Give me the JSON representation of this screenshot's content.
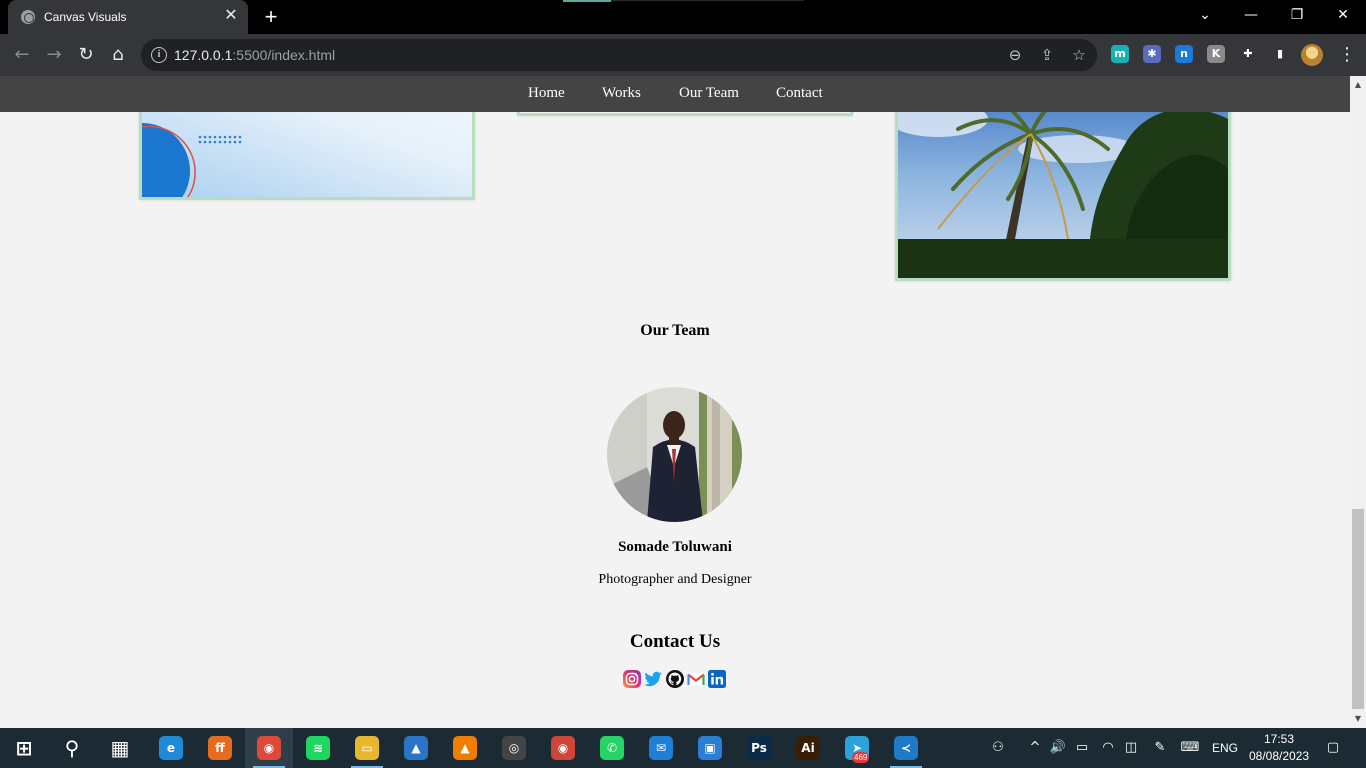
{
  "browser": {
    "tab_title": "Canvas Visuals",
    "tab_close": "✕",
    "new_tab": "+",
    "url_host": "127.0.0.1",
    "url_rest": ":5500/index.html",
    "window_controls": {
      "tabsearch": "⌄",
      "minimize": "—",
      "restore": "❐",
      "close": "✕"
    },
    "nav": {
      "back": "←",
      "forward": "→",
      "reload": "↻",
      "home": "⌂"
    },
    "omnibox_icons": {
      "info": "i",
      "zoom": "⊖",
      "share": "⇪",
      "bookmark": "☆"
    },
    "extensions": [
      {
        "name": "m-extension-icon",
        "label": "m",
        "color": "#1ab1b5"
      },
      {
        "name": "puzzle-color-icon",
        "label": "✱",
        "color": "#5a6bbf"
      },
      {
        "name": "n-extension-icon",
        "label": "n",
        "color": "#1a7ad9"
      },
      {
        "name": "k-extension-icon",
        "label": "K",
        "color": "#8a8a8a"
      },
      {
        "name": "extensions-puzzle-icon",
        "label": "✚",
        "color": "transparent"
      },
      {
        "name": "side-panel-icon",
        "label": "▮",
        "color": "transparent"
      }
    ],
    "menu": "⋮"
  },
  "site": {
    "nav": [
      "Home",
      "Works",
      "Our Team",
      "Contact"
    ],
    "team_heading": "Our Team",
    "member": {
      "name": "Somade Toluwani",
      "role": "Photographer and Designer"
    },
    "contact_heading": "Contact Us",
    "socials": [
      "instagram-icon",
      "twitter-icon",
      "github-icon",
      "gmail-icon",
      "linkedin-icon"
    ]
  },
  "scrollbar": {
    "up": "▲",
    "down": "▼"
  },
  "taskbar": {
    "apps": [
      {
        "name": "start-button",
        "label": "⊞",
        "color": "transparent"
      },
      {
        "name": "search-icon",
        "label": "⚲",
        "color": "transparent"
      },
      {
        "name": "task-view-icon",
        "label": "▦",
        "color": "transparent"
      },
      {
        "name": "edge-icon",
        "label": "e",
        "color": "#1f8ad8"
      },
      {
        "name": "firefox-icon",
        "label": "ff",
        "color": "#e66a1f"
      },
      {
        "name": "chrome-icon",
        "label": "◉",
        "color": "#dd4a3a"
      },
      {
        "name": "spotify-icon",
        "label": "≋",
        "color": "#1ed760"
      },
      {
        "name": "file-explorer-icon",
        "label": "▭",
        "color": "#e8b730"
      },
      {
        "name": "photos-icon",
        "label": "▲",
        "color": "#2a73c9"
      },
      {
        "name": "vlc-icon",
        "label": "▲",
        "color": "#f07c00"
      },
      {
        "name": "media-player-icon",
        "label": "◎",
        "color": "#444"
      },
      {
        "name": "chrome-alt-icon",
        "label": "◉",
        "color": "#cf4537"
      },
      {
        "name": "whatsapp-icon",
        "label": "✆",
        "color": "#25d366"
      },
      {
        "name": "mail-icon",
        "label": "✉",
        "color": "#1f7ed6"
      },
      {
        "name": "store-icon",
        "label": "▣",
        "color": "#2a7fd4"
      },
      {
        "name": "photoshop-icon",
        "label": "Ps",
        "color": "#0b2a45"
      },
      {
        "name": "illustrator-icon",
        "label": "Ai",
        "color": "#3a1d05"
      },
      {
        "name": "telegram-icon",
        "label": "➤",
        "color": "#2aa3dd"
      },
      {
        "name": "vscode-icon",
        "label": "≺",
        "color": "#1f79c9"
      }
    ],
    "telegram_badge": "469",
    "tray": {
      "lang": "ENG",
      "time": "17:53",
      "date": "08/08/2023",
      "chevron": "^",
      "volume": "🔊",
      "battery": "▭",
      "wifi": "◠",
      "people": "⚇",
      "pen": "✎",
      "keyboard": "⌨",
      "camera": "◫",
      "notifications": "▢"
    }
  }
}
